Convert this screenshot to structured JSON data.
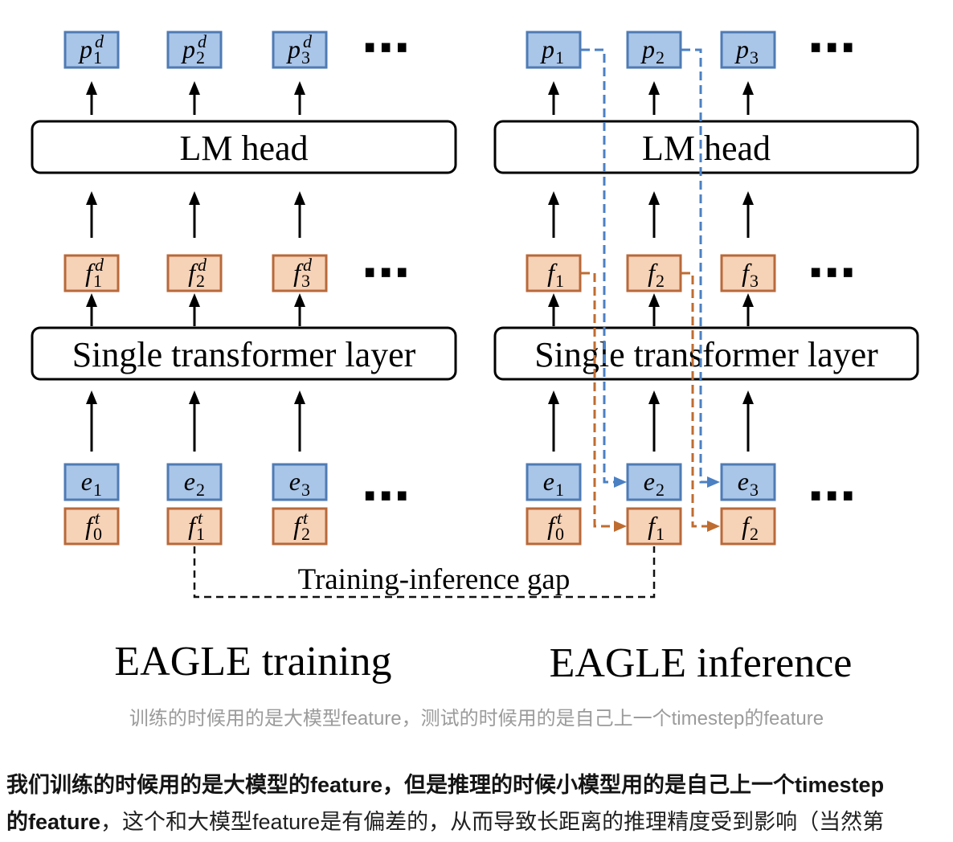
{
  "diagram": {
    "panels": [
      {
        "title": "EAGLE training",
        "lm_head": "LM head",
        "transformer_layer": "Single transformer layer",
        "outputs": [
          {
            "base": "p",
            "sub": "1",
            "sup": "d"
          },
          {
            "base": "p",
            "sub": "2",
            "sup": "d"
          },
          {
            "base": "p",
            "sub": "3",
            "sup": "d"
          }
        ],
        "features": [
          {
            "base": "f",
            "sub": "1",
            "sup": "d"
          },
          {
            "base": "f",
            "sub": "2",
            "sup": "d"
          },
          {
            "base": "f",
            "sub": "3",
            "sup": "d"
          }
        ],
        "embeddings": [
          {
            "base": "e",
            "sub": "1"
          },
          {
            "base": "e",
            "sub": "2"
          },
          {
            "base": "e",
            "sub": "3"
          }
        ],
        "input_features": [
          {
            "base": "f",
            "sub": "0",
            "sup": "t"
          },
          {
            "base": "f",
            "sub": "1",
            "sup": "t"
          },
          {
            "base": "f",
            "sub": "2",
            "sup": "t"
          }
        ]
      },
      {
        "title": "EAGLE inference",
        "lm_head": "LM head",
        "transformer_layer": "Single transformer layer",
        "outputs": [
          {
            "base": "p",
            "sub": "1"
          },
          {
            "base": "p",
            "sub": "2"
          },
          {
            "base": "p",
            "sub": "3"
          }
        ],
        "features": [
          {
            "base": "f",
            "sub": "1"
          },
          {
            "base": "f",
            "sub": "2"
          },
          {
            "base": "f",
            "sub": "3"
          }
        ],
        "embeddings": [
          {
            "base": "e",
            "sub": "1"
          },
          {
            "base": "e",
            "sub": "2"
          },
          {
            "base": "e",
            "sub": "3"
          }
        ],
        "input_features": [
          {
            "base": "f",
            "sub": "0",
            "sup": "t"
          },
          {
            "base": "f",
            "sub": "1"
          },
          {
            "base": "f",
            "sub": "2"
          }
        ]
      }
    ],
    "ellipsis": "⋯",
    "gap_label": "Training-inference gap",
    "colors": {
      "token_box_fill": "#a9c5e8",
      "token_box_stroke": "#4f7bb4",
      "feature_box_fill": "#f6d2b7",
      "feature_box_stroke": "#b8693b",
      "token_feedback_line": "#4b80c3",
      "feature_feedback_line": "#bf6c30",
      "caption_text": "#9b9b9b",
      "body_text": "#1f1f1f"
    }
  },
  "article": {
    "caption": "训练的时候用的是大模型feature，测试的时候用的是自己上一个timestep的feature",
    "paragraph": {
      "line1_bold": "我们训练的时候用的是大模型的feature，但是推理的时候小模型用的是自己上一个timestep",
      "line2_bold": "的feature",
      "line2_regular": "，这个和大模型feature是有偏差的，从而导致长距离的推理精度受到影响（当然第"
    }
  }
}
